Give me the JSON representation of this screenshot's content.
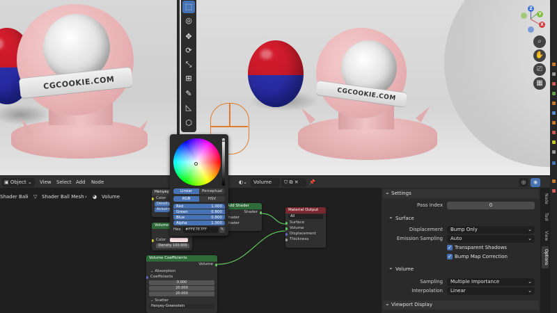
{
  "viewport_left": {
    "ball_label": "CGCOOKIE.COM"
  },
  "viewport_right": {
    "ball_label": "CGCOOKIE.COM"
  },
  "gizmo": {
    "z_label": "Z",
    "y_label": "Y",
    "x_label": "X"
  },
  "header": {
    "mode": "Object",
    "menus": [
      "View",
      "Select",
      "Add",
      "Node"
    ],
    "material_slot": "Volume"
  },
  "breadcrumb": [
    "Shader Ball",
    "Shader Ball Mesh",
    "Volume"
  ],
  "nodes": {
    "henyey": {
      "title": "Henyey",
      "rows": [
        "Color",
        "Density",
        "Anisotropy"
      ]
    },
    "volume_partial": {
      "title": "Volume",
      "color_label": "Color",
      "density_label": "Density",
      "density_value": "100.000"
    },
    "volume_coefficients": {
      "title": "Volume Coefficients",
      "output": "Volume",
      "absorption": "Absorption",
      "coefficients_label": "Coefficients",
      "coefficients": [
        "0.000",
        "20.000",
        "20.000"
      ],
      "scatter": "Scatter",
      "scatter_value": "Henyey-Greenstein"
    },
    "add_shader": {
      "title": "Add Shader",
      "output": "Shader",
      "inputs": [
        "hader",
        "hader"
      ]
    },
    "material_output": {
      "title": "Material Output",
      "target": "All",
      "inputs": [
        "Surface",
        "Volume",
        "Displacement",
        "Thickness"
      ]
    }
  },
  "color_picker": {
    "mode_linear": "Linear",
    "mode_perceptual": "Perceptual",
    "tab_rgb": "RGB",
    "tab_hsv": "HSV",
    "channels": [
      {
        "label": "Red",
        "value": "1.000"
      },
      {
        "label": "Green",
        "value": "0.800"
      },
      {
        "label": "Blue",
        "value": "0.800"
      },
      {
        "label": "Alpha",
        "value": "1.000"
      }
    ],
    "hex_label": "Hex",
    "hex_value": "#FFE7E7FF"
  },
  "properties": {
    "settings": "Settings",
    "pass_index_label": "Pass Index",
    "pass_index_value": "0",
    "surface": "Surface",
    "displacement_label": "Displacement",
    "displacement_value": "Bump Only",
    "emission_label": "Emission Sampling",
    "emission_value": "Auto",
    "transparent_shadows": "Transparent Shadows",
    "bump_correction": "Bump Map Correction",
    "volume": "Volume",
    "sampling_label": "Sampling",
    "sampling_value": "Multiple Importance",
    "interpolation_label": "Interpolation",
    "interpolation_value": "Linear",
    "viewport_display": "Viewport Display"
  },
  "side_tabs": [
    "Node",
    "Tool",
    "View",
    "Options"
  ],
  "colors": {
    "accent": "#4772b3",
    "node_green": "#2e6b38",
    "node_red": "#7c2830",
    "picked": "#FFE7E7"
  }
}
